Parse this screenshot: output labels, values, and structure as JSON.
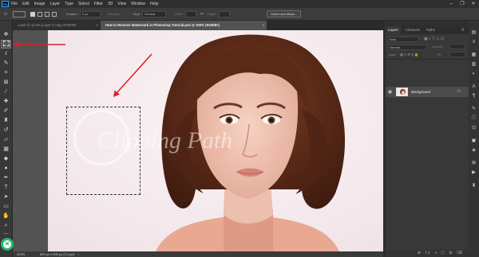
{
  "app": {
    "logo": "Ps"
  },
  "menu": [
    "File",
    "Edit",
    "Image",
    "Layer",
    "Type",
    "Select",
    "Filter",
    "3D",
    "View",
    "Window",
    "Help"
  ],
  "window_controls": {
    "minimize": "─",
    "restore": "❐",
    "close": "✕"
  },
  "options_bar": {
    "feather_label": "Feather:",
    "feather_value": "0 px",
    "antialias_label": "Anti-alias",
    "style_label": "Style:",
    "style_value": "Normal",
    "width_label": "Width:",
    "height_label": "Height:",
    "select_mask_label": "Select and Mask..."
  },
  "tabs": [
    {
      "label": "1.psd @ 12.5% (Layer 0 copy, RGB/8#)",
      "active": false
    },
    {
      "label": "How to Remove Watermark in Photoshop Tutorial.psd @ 200% (RGB/8#)",
      "active": true
    }
  ],
  "tab_close_glyph": "×",
  "watermark": {
    "text": "Clipping Path"
  },
  "status": {
    "zoom": "200%",
    "doc_size": "600 px x 600 px (72 ppi)"
  },
  "layers_panel": {
    "tabs": [
      "Layers",
      "Channels",
      "Paths"
    ],
    "kind_label": "Kind",
    "blend_mode": "Normal",
    "opacity_label": "Opacity:",
    "lock_label": "Lock:",
    "fill_label": "Fill:",
    "layer_name": "Background"
  },
  "colors": {
    "accent": "#31a8ff",
    "arrow": "#d8232a",
    "panel": "#383838",
    "canvas_bg": "#535353"
  }
}
